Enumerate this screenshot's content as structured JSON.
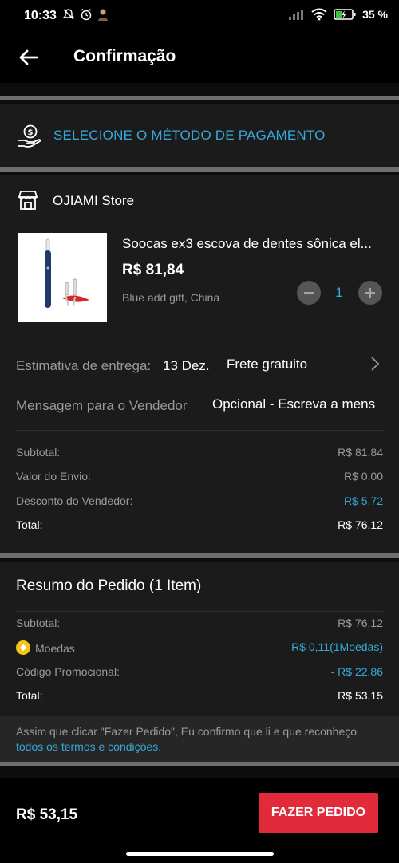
{
  "status_bar": {
    "time": "10:33",
    "battery": "35 %"
  },
  "header": {
    "title": "Confirmação"
  },
  "payment": {
    "label": "SELECIONE O MÉTODO DE PAGAMENTO"
  },
  "store": {
    "name": "OJIAMI Store",
    "product": {
      "name": "Soocas ex3 escova de dentes sônica el...",
      "price": "R$ 81,84",
      "variant": "Blue add gift, China",
      "quantity": "1"
    },
    "delivery": {
      "label": "Estimativa de entrega:",
      "date": "13 Dez.",
      "shipping": "Frete gratuito"
    },
    "message": {
      "label": "Mensagem para o Vendedor",
      "placeholder": "Opcional - Escreva a mens"
    },
    "breakdown": [
      {
        "label": "Subtotal:",
        "value": "R$ 81,84"
      },
      {
        "label": "Valor do Envio:",
        "value": "R$ 0,00"
      },
      {
        "label": "Desconto do Vendedor:",
        "value": "- R$ 5,72"
      },
      {
        "label": "Total:",
        "value": "R$ 76,12"
      }
    ]
  },
  "summary": {
    "title": "Resumo do Pedido (1 Item)",
    "rows": [
      {
        "label": "Subtotal:",
        "value": "R$ 76,12"
      },
      {
        "label": "Moedas",
        "value": "- R$ 0,11(1Moedas)"
      },
      {
        "label": "Código Promocional:",
        "value": "- R$ 22,86"
      },
      {
        "label": "Total:",
        "value": "R$ 53,15"
      }
    ]
  },
  "disclaimer": {
    "text": "Assim que clicar \"Fazer Pedido\", Eu confirmo que li e que reconheço ",
    "link": "todos os termos e condições."
  },
  "footer": {
    "total": "R$ 53,15",
    "button": "FAZER PEDIDO"
  },
  "colors": {
    "accent": "#38a8d8",
    "cta": "#e12b3a",
    "background": "#1b1b1b"
  }
}
